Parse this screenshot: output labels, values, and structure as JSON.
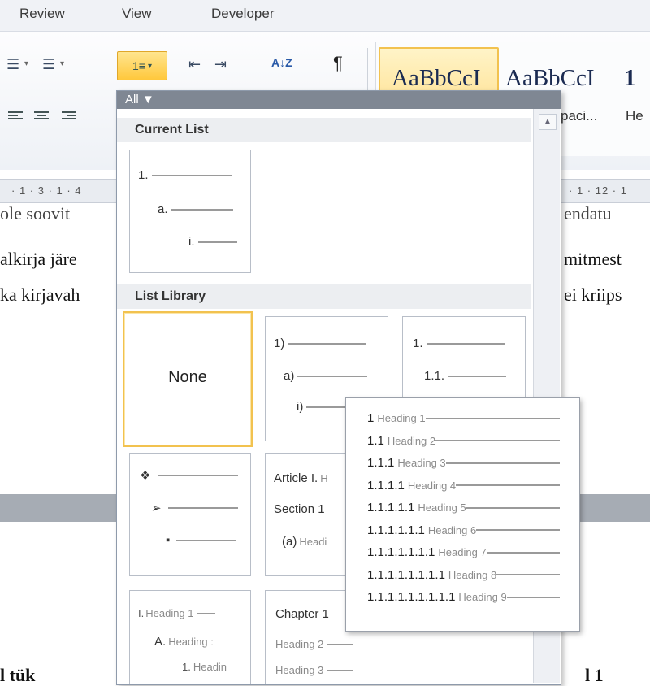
{
  "menu": {
    "tabs": [
      "Review",
      "View",
      "Developer"
    ]
  },
  "ribbon": {
    "icons": {
      "bullets": "☰",
      "numbering": "☰",
      "multilevel": "1≡",
      "decrease_indent": "⇤",
      "increase_indent": "⇥",
      "sort": "A↓Z",
      "pilcrow": "¶"
    },
    "styles": [
      {
        "sample": "AaBbCcI",
        "name": ""
      },
      {
        "sample": "AaBbCcI",
        "name": "paci..."
      },
      {
        "sample": "1",
        "name": "He"
      }
    ]
  },
  "ruler": {
    "left": "· 1 · 3 · 1 · 4",
    "right": "· 1 · 12 · 1"
  },
  "document": {
    "line1_left": "ole soovit",
    "line1_right": "endatu",
    "line2_left": "alkirja järe",
    "line2_right": "mitmest",
    "line3_left": "ka kirjavah",
    "line3_right": "ei kriips",
    "bottom_left": "l    tük",
    "bottom_right": "l    1"
  },
  "dropdown": {
    "filter": "All ▼",
    "current_list_heading": "Current List",
    "list_library_heading": "List Library",
    "current_list": [
      "1.",
      "a.",
      "i."
    ],
    "library": {
      "none_label": "None",
      "numbered_paren": [
        "1)",
        "a)",
        "i)"
      ],
      "decimal": [
        "1.",
        "1.1."
      ],
      "bullets": [
        "❖",
        "➢",
        "▪"
      ],
      "article": [
        {
          "num": "Article I.",
          "heading": "H"
        },
        {
          "num": "Section 1",
          "heading": ""
        },
        {
          "num": "(a)",
          "heading": "Headi"
        }
      ],
      "roman": [
        {
          "num": "I.",
          "heading": "Heading 1"
        },
        {
          "num": "A.",
          "heading": "Heading :"
        },
        {
          "num": "1.",
          "heading": "Headin"
        }
      ],
      "chapter": [
        {
          "num": "Chapter 1",
          "heading": ""
        },
        {
          "num": "",
          "heading": "Heading 2"
        },
        {
          "num": "",
          "heading": "Heading 3"
        }
      ]
    },
    "scroll_up": "▲"
  },
  "tooltip": {
    "rows": [
      {
        "num": "1",
        "heading": "Heading 1"
      },
      {
        "num": "1.1",
        "heading": "Heading 2"
      },
      {
        "num": "1.1.1",
        "heading": "Heading 3"
      },
      {
        "num": "1.1.1.1",
        "heading": "Heading 4"
      },
      {
        "num": "1.1.1.1.1",
        "heading": "Heading 5"
      },
      {
        "num": "1.1.1.1.1.1",
        "heading": "Heading 6"
      },
      {
        "num": "1.1.1.1.1.1.1",
        "heading": "Heading 7"
      },
      {
        "num": "1.1.1.1.1.1.1.1",
        "heading": "Heading 8"
      },
      {
        "num": "1.1.1.1.1.1.1.1.1",
        "heading": "Heading 9"
      }
    ]
  },
  "colors": {
    "accent_selected": "#f2c24f",
    "dropdown_header": "#7f8793",
    "section_bg": "#eceef1"
  }
}
